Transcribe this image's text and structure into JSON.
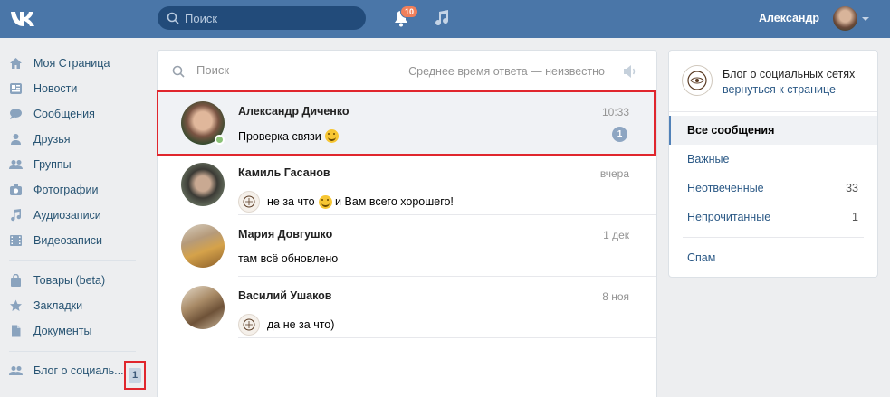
{
  "header": {
    "logo": "VK",
    "search_placeholder": "Поиск",
    "notifications_count": "10",
    "user_name": "Александр"
  },
  "nav": {
    "items": [
      {
        "label": "Моя Страница",
        "icon": "home-icon"
      },
      {
        "label": "Новости",
        "icon": "news-icon"
      },
      {
        "label": "Сообщения",
        "icon": "messages-icon"
      },
      {
        "label": "Друзья",
        "icon": "friends-icon"
      },
      {
        "label": "Группы",
        "icon": "groups-icon"
      },
      {
        "label": "Фотографии",
        "icon": "camera-icon"
      },
      {
        "label": "Аудиозаписи",
        "icon": "music-note-icon"
      },
      {
        "label": "Видеозаписи",
        "icon": "video-icon"
      }
    ],
    "items2": [
      {
        "label": "Товары (beta)",
        "icon": "bag-icon"
      },
      {
        "label": "Закладки",
        "icon": "star-icon"
      },
      {
        "label": "Документы",
        "icon": "document-icon"
      }
    ],
    "group": {
      "label": "Блог о социаль...",
      "count": "1"
    }
  },
  "im": {
    "search_placeholder": "Поиск",
    "avg_response": "Среднее время ответа — неизвестно",
    "conversations": [
      {
        "name": "Александр Диченко",
        "time": "10:33",
        "message": "Проверка связи",
        "unread": "1"
      },
      {
        "name": "Камиль Гасанов",
        "time": "вчера",
        "message": "не за что",
        "message2": "и Вам всего хорошего!"
      },
      {
        "name": "Мария Довгушко",
        "time": "1 дек",
        "message": "там всё обновлено"
      },
      {
        "name": "Василий Ушаков",
        "time": "8 ноя",
        "message": "да не за что)"
      }
    ]
  },
  "right_panel": {
    "title": "Блог о социальных сетях",
    "back": "вернуться к странице",
    "filters": [
      {
        "label": "Все сообщения",
        "count": ""
      },
      {
        "label": "Важные",
        "count": ""
      },
      {
        "label": "Неотвеченные",
        "count": "33"
      },
      {
        "label": "Непрочитанные",
        "count": "1"
      }
    ],
    "spam": "Спам"
  },
  "colors": {
    "header_bg": "#4a76a8",
    "accent": "#2a5885",
    "highlight": "#e0262d"
  }
}
